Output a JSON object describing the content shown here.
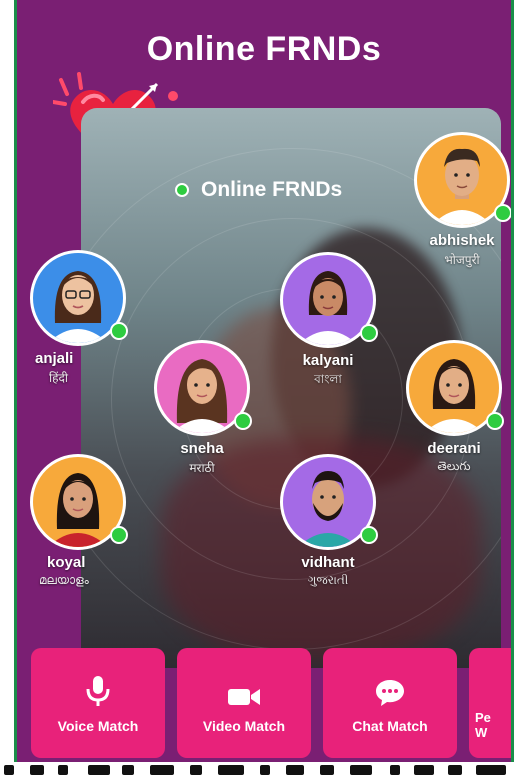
{
  "header": {
    "title": "Online FRNDs"
  },
  "card": {
    "online_label": "Online FRNDs"
  },
  "users": [
    {
      "name": "abhishek",
      "lang": "भोजपुरी",
      "bg": "#f7a93b"
    },
    {
      "name": "anjali",
      "lang": "हिंदी",
      "bg": "#3c8ee8"
    },
    {
      "name": "kalyani",
      "lang": "বাংলা",
      "bg": "#a46ae6"
    },
    {
      "name": "sneha",
      "lang": "मराठी",
      "bg": "#e96bc2"
    },
    {
      "name": "deerani",
      "lang": "తెలుగు",
      "bg": "#f7a93b"
    },
    {
      "name": "koyal",
      "lang": "മലയാളം",
      "bg": "#f7a93b"
    },
    {
      "name": "vidhant",
      "lang": "ગુજરાતી",
      "bg": "#a46ae6"
    }
  ],
  "actions": [
    {
      "label": "Voice Match",
      "icon": "microphone-icon"
    },
    {
      "label": "Video Match",
      "icon": "video-camera-icon"
    },
    {
      "label": "Chat Match",
      "icon": "chat-bubble-icon"
    },
    {
      "label": "Pe W",
      "icon": ""
    }
  ],
  "colors": {
    "background": "#7a1f73",
    "accent": "#e8227a",
    "online": "#2ecc40"
  }
}
